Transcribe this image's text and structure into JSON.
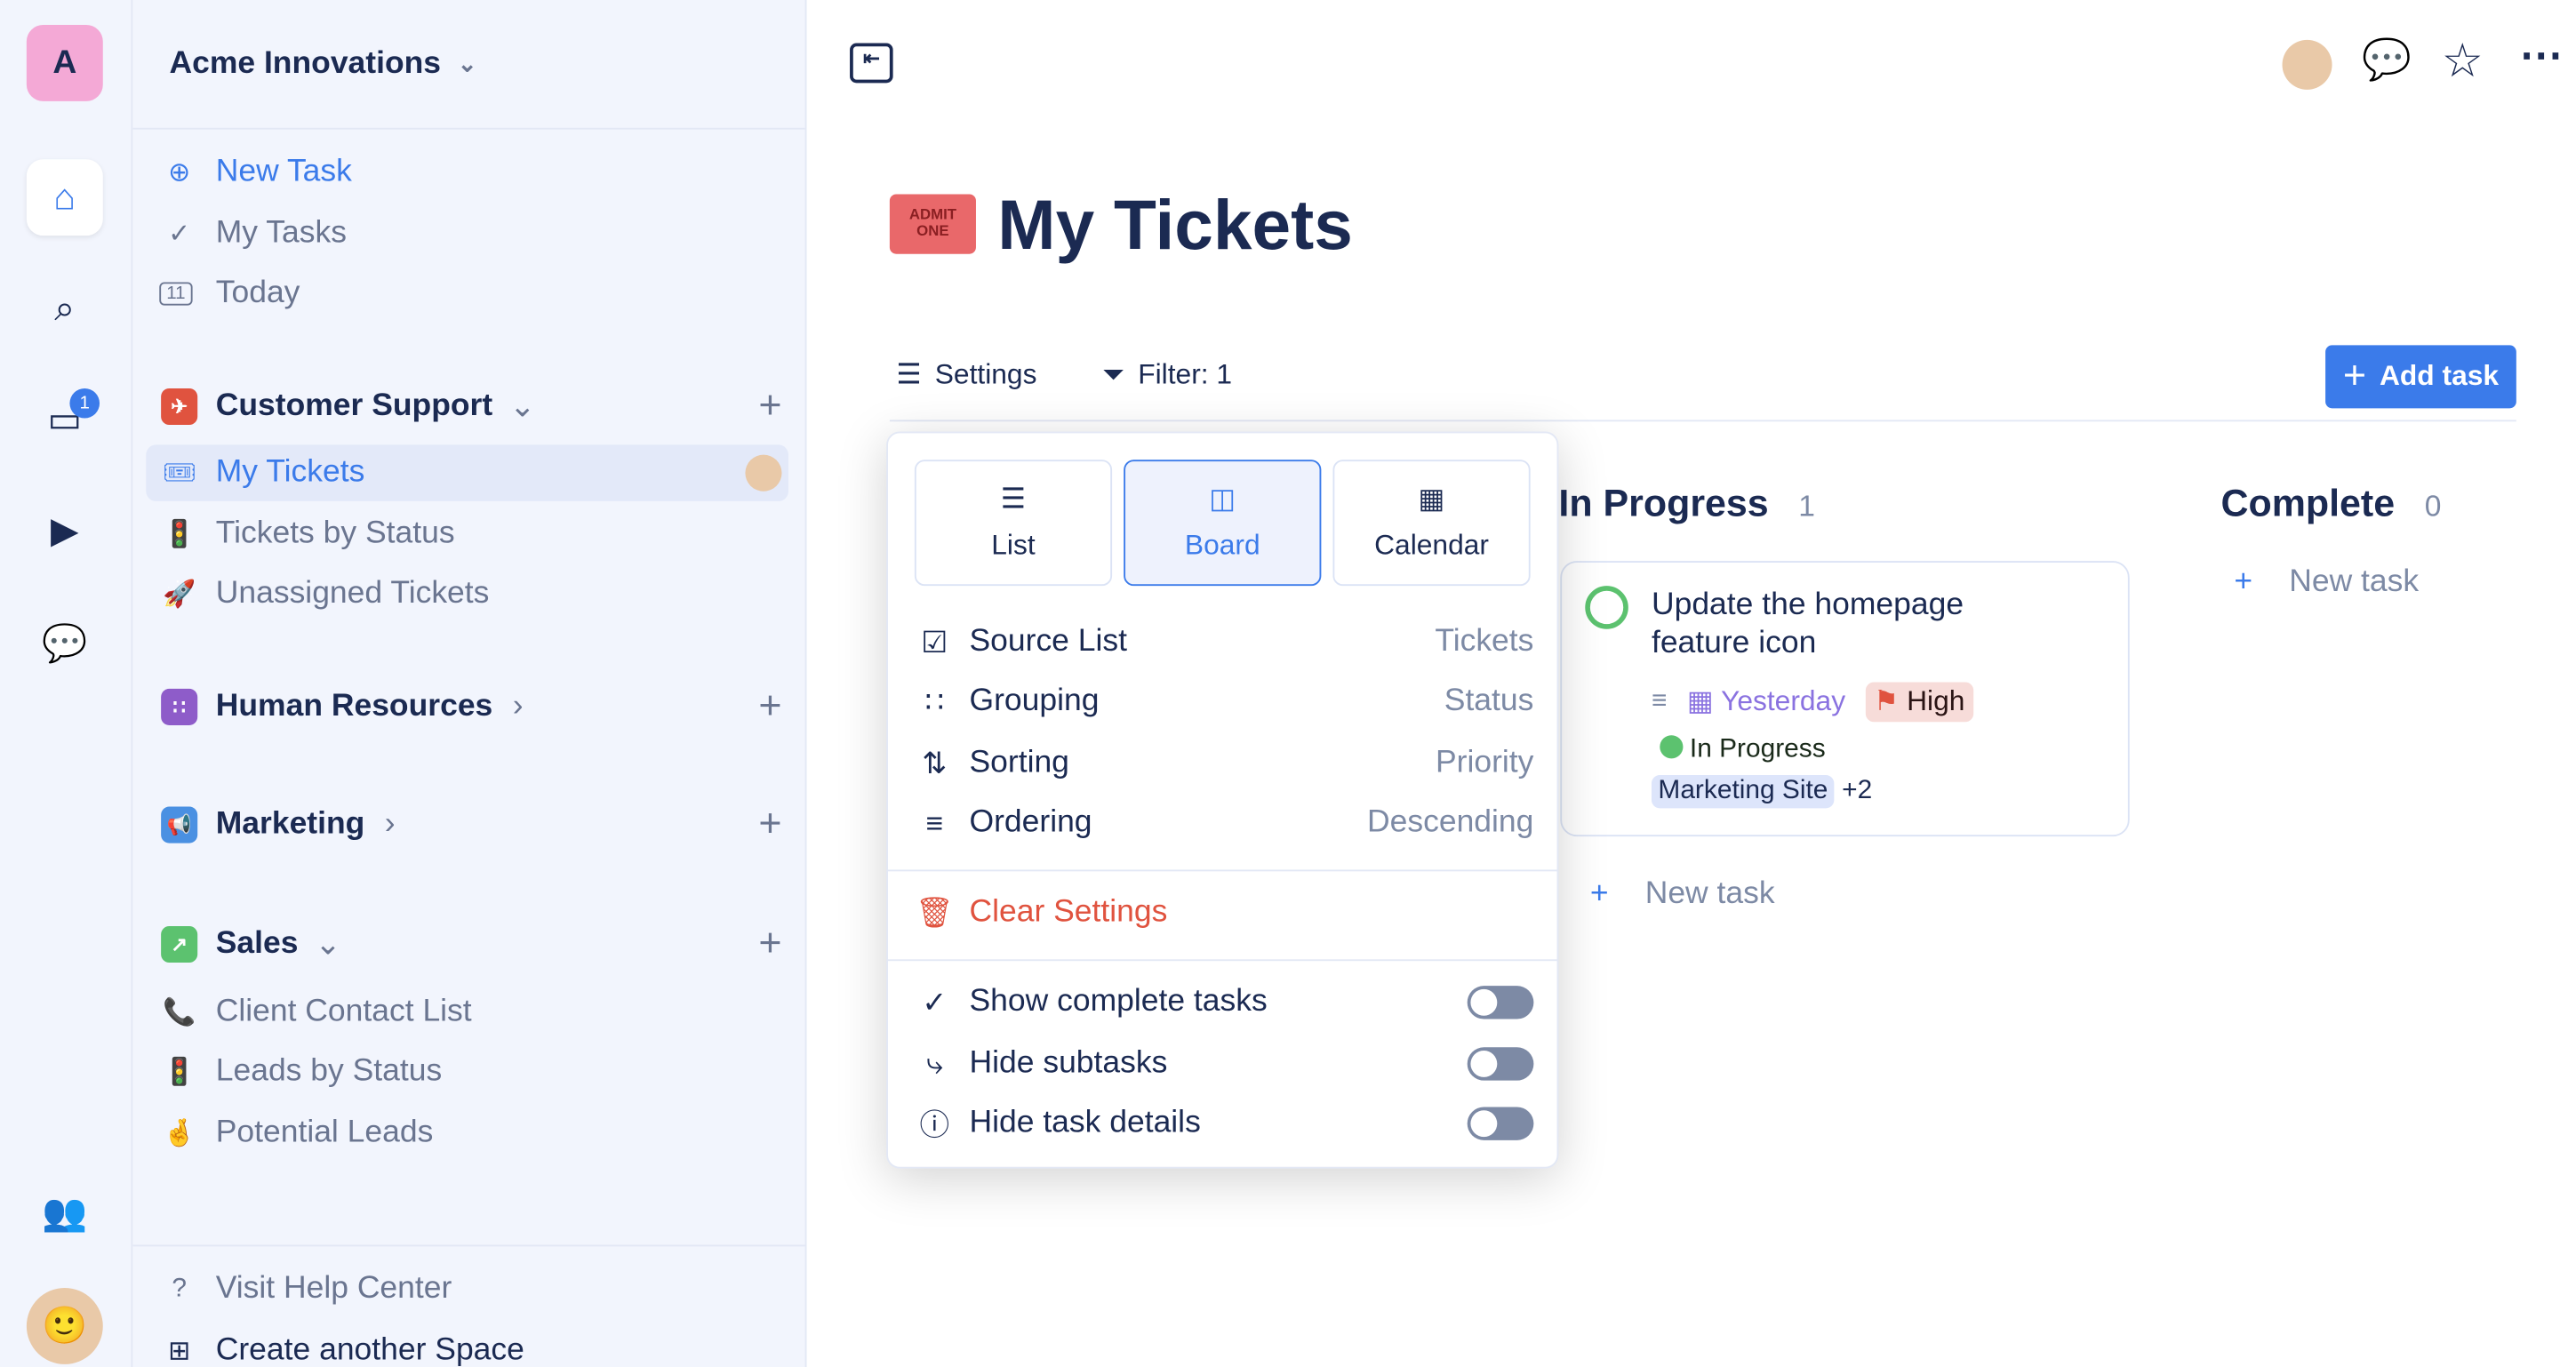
{
  "workspace": {
    "initial": "A",
    "name": "Acme Innovations"
  },
  "rail": {
    "inbox_badge": "1"
  },
  "sidebar": {
    "top": [
      {
        "label": "New Task",
        "icon": "plus-circle-icon"
      },
      {
        "label": "My Tasks",
        "icon": "check-circle-icon"
      },
      {
        "label": "Today",
        "icon": "calendar-icon",
        "day": "11"
      }
    ],
    "groups": [
      {
        "label": "Customer Support",
        "color": "#e0533f",
        "expanded": true,
        "items": [
          {
            "label": "My Tickets",
            "icon": "ticket-icon",
            "selected": true
          },
          {
            "label": "Tickets by Status",
            "icon": "traffic-light-icon"
          },
          {
            "label": "Unassigned Tickets",
            "icon": "rocket-icon"
          }
        ]
      },
      {
        "label": "Human Resources",
        "color": "#8e5cc9",
        "expanded": false
      },
      {
        "label": "Marketing",
        "color": "#4a90e2",
        "expanded": false
      },
      {
        "label": "Sales",
        "color": "#5cc26f",
        "expanded": true,
        "items": [
          {
            "label": "Client Contact List",
            "icon": "phone-icon"
          },
          {
            "label": "Leads by Status",
            "icon": "traffic-light-icon"
          },
          {
            "label": "Potential Leads",
            "icon": "fingers-crossed-icon"
          }
        ]
      }
    ],
    "footer": [
      {
        "label": "Visit Help Center",
        "icon": "help-icon"
      },
      {
        "label": "Create another Space",
        "icon": "plus-square-icon"
      }
    ]
  },
  "page": {
    "title": "My Tickets",
    "settings_label": "Settings",
    "filter_label": "Filter: 1",
    "add_task_label": "Add task"
  },
  "settings_popup": {
    "views": [
      {
        "label": "List"
      },
      {
        "label": "Board",
        "active": true
      },
      {
        "label": "Calendar"
      }
    ],
    "rows": [
      {
        "label": "Source List",
        "value": "Tickets"
      },
      {
        "label": "Grouping",
        "value": "Status"
      },
      {
        "label": "Sorting",
        "value": "Priority"
      },
      {
        "label": "Ordering",
        "value": "Descending"
      }
    ],
    "clear_label": "Clear Settings",
    "toggles": [
      {
        "label": "Show complete tasks",
        "on": false
      },
      {
        "label": "Hide subtasks",
        "on": false
      },
      {
        "label": "Hide task details",
        "on": false
      }
    ]
  },
  "board": {
    "columns": [
      {
        "title": "In Progress",
        "count": "1"
      },
      {
        "title": "Complete",
        "count": "0"
      }
    ],
    "new_task_label": "New task",
    "card": {
      "title": "Update the homepage feature icon",
      "date": "Yesterday",
      "priority": "High",
      "status": "In Progress",
      "tag": "Marketing Site",
      "more_tags": "+2"
    }
  },
  "colors": {
    "accent": "#3b7bea",
    "danger": "#e0533f",
    "success": "#5cc26f"
  }
}
